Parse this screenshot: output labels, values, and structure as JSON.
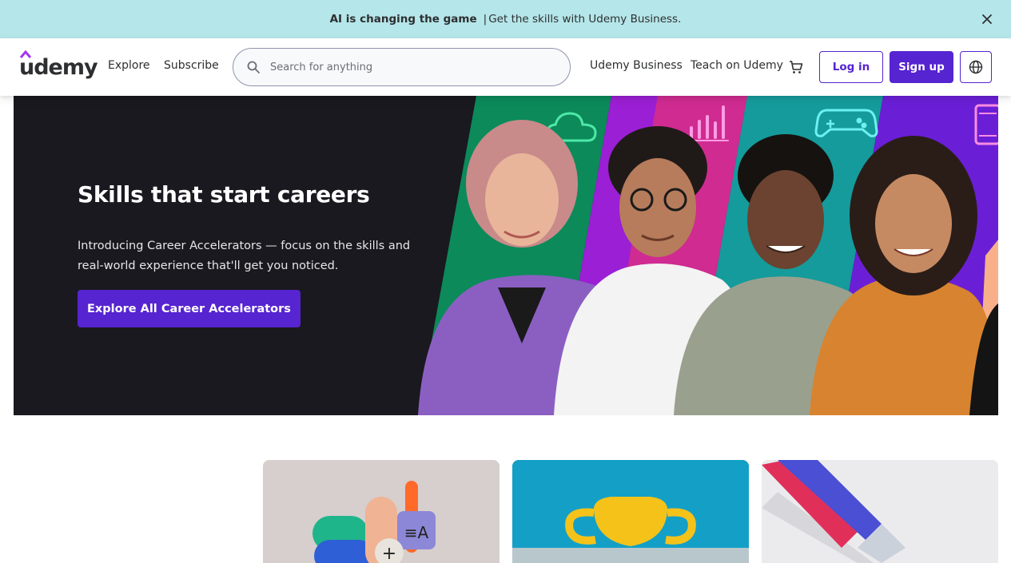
{
  "banner": {
    "headline": "AI is changing the game",
    "separator": "|",
    "text": "Get the skills with Udemy Business.",
    "close_icon": "close-icon"
  },
  "header": {
    "logo_text": "udemy",
    "nav": {
      "explore": "Explore",
      "subscribe": "Subscribe",
      "business": "Udemy Business",
      "teach": "Teach on Udemy"
    },
    "search": {
      "placeholder": "Search for anything",
      "value": "",
      "icon": "search-icon"
    },
    "cart_icon": "cart-icon",
    "login_label": "Log in",
    "signup_label": "Sign up",
    "language_icon": "globe-icon"
  },
  "hero": {
    "title": "Skills that start careers",
    "description": "Introducing Career Accelerators — focus on the skills and real-world experience that'll get you noticed.",
    "cta_label": "Explore All Career Accelerators",
    "stripe_icons": [
      "cloud-icon",
      "bar-chart-icon",
      "gamepad-icon",
      "phone-icon"
    ]
  },
  "cards": [
    {
      "name": "career-card-building-blocks"
    },
    {
      "name": "career-card-trophy"
    },
    {
      "name": "career-card-ribbon"
    }
  ],
  "colors": {
    "brand_purple": "#5624d0",
    "banner_bg": "#b5e6e9",
    "hero_bg": "#1a191f",
    "text_dark": "#2d2f31"
  }
}
